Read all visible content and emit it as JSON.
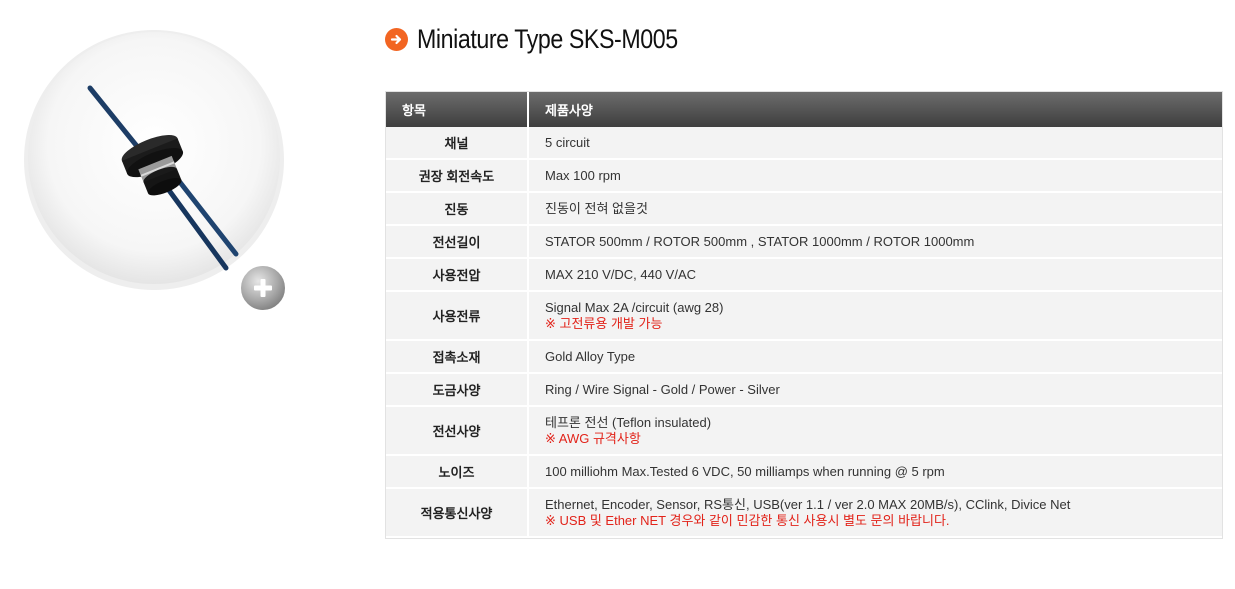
{
  "product": {
    "title": "Miniature Type SKS-M005"
  },
  "table": {
    "headers": {
      "item": "항목",
      "spec": "제품사양"
    },
    "rows": [
      {
        "item": "채널",
        "value": "5 circuit",
        "note": ""
      },
      {
        "item": "권장 회전속도",
        "value": "Max 100 rpm",
        "note": ""
      },
      {
        "item": "진동",
        "value": "진동이 전혀 없을것",
        "note": ""
      },
      {
        "item": "전선길이",
        "value": "STATOR 500mm / ROTOR 500mm , STATOR 1000mm / ROTOR 1000mm",
        "note": ""
      },
      {
        "item": "사용전압",
        "value": "MAX 210 V/DC, 440 V/AC",
        "note": ""
      },
      {
        "item": "사용전류",
        "value": "Signal Max 2A /circuit (awg 28)",
        "note": "※ 고전류용 개발 가능"
      },
      {
        "item": "접촉소재",
        "value": "Gold Alloy Type",
        "note": ""
      },
      {
        "item": "도금사양",
        "value": "Ring / Wire  Signal - Gold / Power - Silver",
        "note": ""
      },
      {
        "item": "전선사양",
        "value": "테프론 전선 (Teflon insulated)",
        "note": "※ AWG 규격사항"
      },
      {
        "item": "노이즈",
        "value": "100 milliohm Max.Tested 6 VDC, 50 milliamps when running @ 5 rpm",
        "note": ""
      },
      {
        "item": "적용통신사양",
        "value": "Ethernet, Encoder, Sensor, RS통신, USB(ver 1.1 / ver 2.0 MAX 20MB/s), CClink, Divice Net",
        "note": "※ USB 및 Ether NET 경우와 같이 민감한 통신 사용시 별도 문의 바랍니다."
      }
    ]
  },
  "colors": {
    "accent": "#f26522",
    "note": "#e2231a",
    "header_bg": "#4a4a4a",
    "cell_bg": "#f3f3f3"
  },
  "icons": {
    "title": "arrow-right-circle-icon",
    "zoom": "plus-icon"
  }
}
